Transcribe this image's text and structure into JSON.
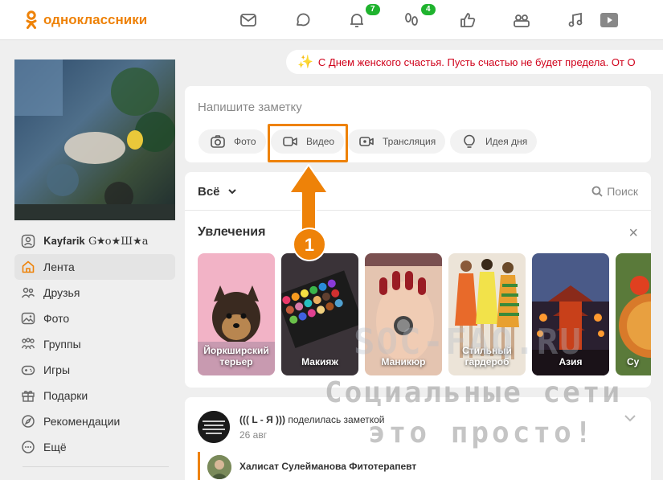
{
  "header": {
    "logo_text": "одноклассники",
    "brand_color": "#ee8208",
    "nav_icons": [
      "mail-icon",
      "discussions-icon",
      "notifications-icon",
      "guests-icon",
      "events-icon",
      "friends-icon",
      "music-icon",
      "video-icon"
    ],
    "notifications_badge": "7",
    "guests_badge": "4",
    "badge_color": "#1fb32e"
  },
  "sidebar": {
    "profile_name": "𝐊𝐚𝐲𝐟𝐚𝐫𝐢𝐤 G★о★Ш★а",
    "items": [
      {
        "label": "Лента",
        "icon": "home-icon"
      },
      {
        "label": "Друзья",
        "icon": "friends-icon"
      },
      {
        "label": "Фото",
        "icon": "photo-icon"
      },
      {
        "label": "Группы",
        "icon": "groups-icon"
      },
      {
        "label": "Игры",
        "icon": "games-icon"
      },
      {
        "label": "Подарки",
        "icon": "gift-icon"
      },
      {
        "label": "Рекомендации",
        "icon": "compass-icon"
      },
      {
        "label": "Ещё",
        "icon": "more-icon"
      }
    ]
  },
  "announcement": {
    "text": "С Днем женского счастья. Пусть счастью не будет предела. От О",
    "color": "#d0021b"
  },
  "note": {
    "placeholder": "Напишите заметку",
    "buttons": [
      {
        "label": "Фото",
        "icon": "camera-icon"
      },
      {
        "label": "Видео",
        "icon": "video-camera-icon"
      },
      {
        "label": "Трансляция",
        "icon": "live-icon"
      },
      {
        "label": "Идея дня",
        "icon": "lightbulb-icon"
      }
    ]
  },
  "feed": {
    "filter_label": "Всё",
    "search_label": "Поиск",
    "hobbies_title": "Увлечения",
    "hobbies": [
      {
        "label": "Йоркширский терьер"
      },
      {
        "label": "Макияж"
      },
      {
        "label": "Маникюр"
      },
      {
        "label": "Стильный гардероб"
      },
      {
        "label": "Азия"
      },
      {
        "label": "Су"
      }
    ]
  },
  "post": {
    "author": "((( L - Я )))",
    "action": "поделилась заметкой",
    "date": "26 авг",
    "shared_author": "Халисат Сулейманова Фитотерапевт"
  },
  "annotation": {
    "step_number": "1"
  },
  "watermark": {
    "line1": "Социальные сети",
    "line2": "это просто!",
    "site": "SOC-FAQ.RU"
  }
}
